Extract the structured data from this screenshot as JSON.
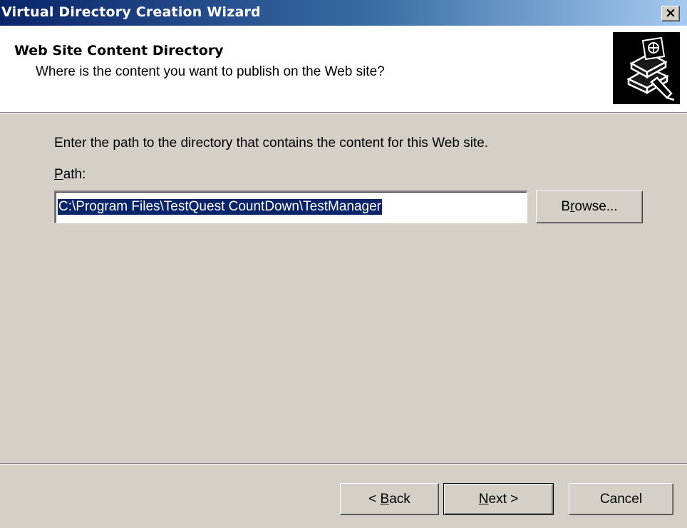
{
  "window": {
    "title": "Virtual Directory Creation Wizard",
    "close_glyph": "×"
  },
  "header": {
    "title": "Web Site Content Directory",
    "subtitle": "Where is the content you want to publish on the Web site?",
    "icon": "wizard-book-icon"
  },
  "body": {
    "instruction": "Enter the path to the directory that contains the content for this Web site.",
    "path_label_mnemonic": "P",
    "path_label_rest": "ath:",
    "path_value": "C:\\Program Files\\TestQuest CountDown\\TestManager",
    "browse_pre": "B",
    "browse_mnemonic": "r",
    "browse_post": "owse..."
  },
  "footer": {
    "back_pre": "< ",
    "back_mnemonic": "B",
    "back_post": "ack",
    "next_mnemonic": "N",
    "next_post": "ext >",
    "cancel_label": "Cancel"
  },
  "colors": {
    "title_gradient_start": "#0a246a",
    "title_gradient_end": "#a6caf0",
    "dialog_face": "#d4d0c8",
    "selection": "#0a246a"
  }
}
